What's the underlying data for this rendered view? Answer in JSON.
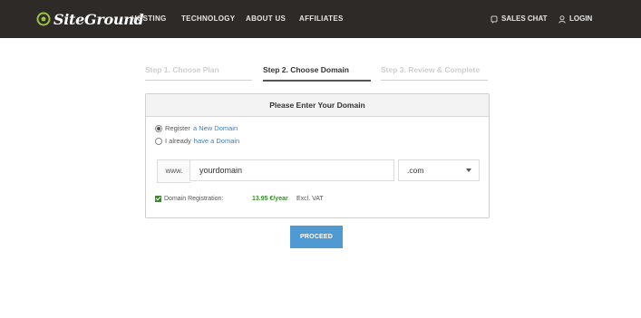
{
  "brand": {
    "name": "SiteGround"
  },
  "nav": {
    "items": [
      "HOSTING",
      "TECHNOLOGY",
      "ABOUT US",
      "AFFILIATES"
    ]
  },
  "header_links": {
    "sales_chat": "SALES CHAT",
    "login": "LOGIN"
  },
  "steps": [
    {
      "label": "Step 1. Choose Plan",
      "state": "inactive"
    },
    {
      "label": "Step 2. Choose Domain",
      "state": "active"
    },
    {
      "label": "Step 3. Review & Complete",
      "state": "inactive"
    }
  ],
  "card": {
    "title": "Please Enter Your Domain",
    "option_register": {
      "prefix": "Register",
      "link": "a New Domain",
      "selected": true
    },
    "option_existing": {
      "prefix": "I already",
      "link": "have a Domain",
      "selected": false
    },
    "prefix": "www.",
    "domain_value": "yourdomain",
    "tld_selected": ".com",
    "registration_label": "Domain Registration:",
    "registration_price": "13.95 €/year",
    "registration_note": "Excl. VAT"
  },
  "proceed_label": "PROCEED",
  "colors": {
    "header_bg": "#2d2a27",
    "accent_green": "#3b8a2e",
    "button_blue": "#4f9ad3",
    "link_blue": "#3a7fc1"
  },
  "icons": {
    "logo": "siteground-logo-icon",
    "chat": "chat-icon",
    "user": "user-icon",
    "dropdown": "chevron-down-icon",
    "checkbox": "checkbox-checked-icon"
  }
}
